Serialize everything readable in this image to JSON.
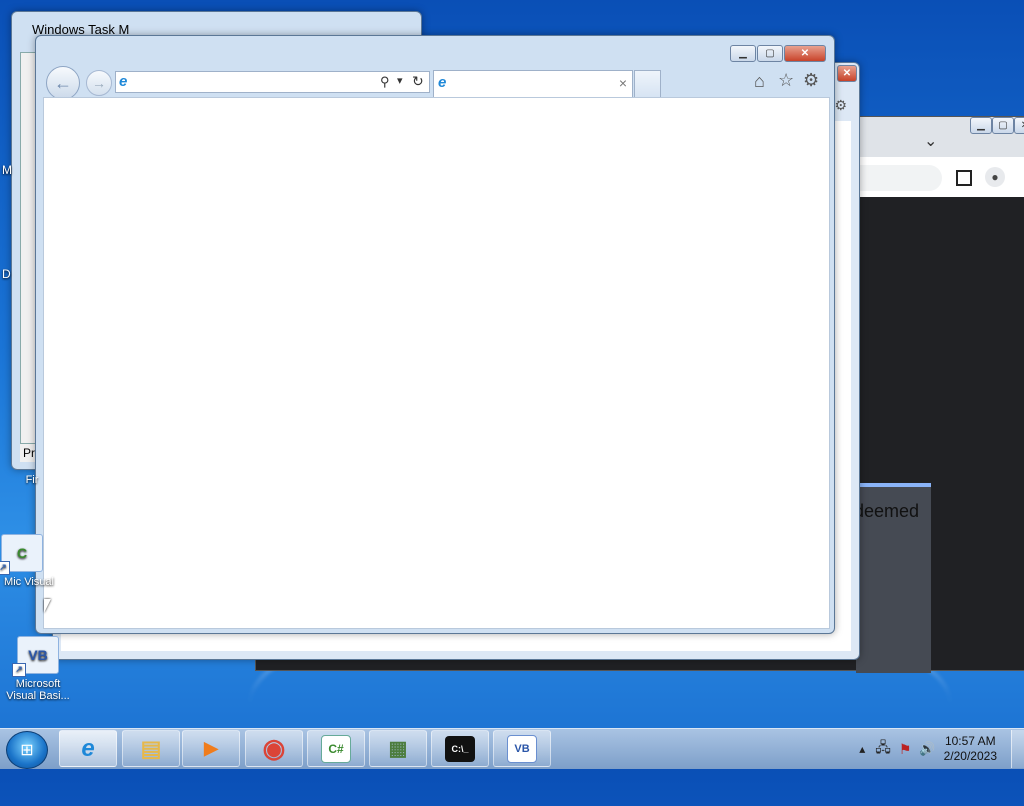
{
  "back_window": {
    "title": "Windows Task M",
    "bottom_tab_label": "Pro",
    "desktop_labels": [
      "M",
      "D"
    ]
  },
  "mid_window": {},
  "chrome_window": {
    "page_text": "deemed",
    "chevron": "⌄"
  },
  "ie_window": {
    "address_value": "",
    "address_placeholder": "",
    "tab_title": "",
    "tab_close": "×",
    "search_glyph": "⚲",
    "dropdown_glyph": "▾",
    "refresh_glyph": "↻",
    "home_glyph": "⌂",
    "favorites_glyph": "☆",
    "tools_glyph": "⚙",
    "back_glyph": "←",
    "forward_glyph": "→"
  },
  "desktop_icons": [
    {
      "label": "Fir",
      "icon": "firefox-icon"
    },
    {
      "label": "Mic Visual",
      "icon": "visual-csharp-icon"
    },
    {
      "label": "Microsoft Visual Basi...",
      "icon": "visual-basic-icon"
    }
  ],
  "taskbar": {
    "items": [
      {
        "name": "internet-explorer",
        "glyph": "e",
        "color": "#1e88d8",
        "active": true
      },
      {
        "name": "file-explorer",
        "glyph": "▤",
        "color": "#e6b84a",
        "active": false
      },
      {
        "name": "media-player",
        "glyph": "▶",
        "color": "#f07c1c",
        "active": false
      },
      {
        "name": "chrome",
        "glyph": "◉",
        "color": "#db4437",
        "active": false
      },
      {
        "name": "visual-csharp",
        "glyph": "C#",
        "color": "#3a8a2e",
        "active": false
      },
      {
        "name": "task-manager",
        "glyph": "▦",
        "color": "#4c7d3e",
        "active": false
      },
      {
        "name": "command-prompt",
        "glyph": "C:\\_",
        "color": "#111111",
        "active": false
      },
      {
        "name": "visual-basic",
        "glyph": "VB",
        "color": "#2b56a8",
        "active": false
      }
    ],
    "clock_time": "10:57 AM",
    "clock_date": "2/20/2023",
    "tray_up": "▴",
    "tray_network": "🖧",
    "tray_flag": "⚑",
    "tray_volume": "🔊"
  },
  "colors": {
    "accent": "#1a74d6",
    "close_red": "#c8432a"
  }
}
